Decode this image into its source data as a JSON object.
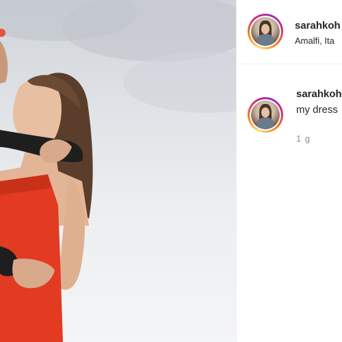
{
  "post": {
    "image_icon": "photo-couple-icon"
  },
  "header": {
    "username": "sarahkoh",
    "location": "Amalfi, Ita"
  },
  "comment": {
    "username": "sarahkoh",
    "caption": "my dress",
    "timestamp": "1 g"
  },
  "colors": {
    "dress": "#e23b22",
    "ring_start": "#feda75",
    "ring_end": "#d62976",
    "divider": "#efefef",
    "timestamp": "#8e8e8e"
  }
}
